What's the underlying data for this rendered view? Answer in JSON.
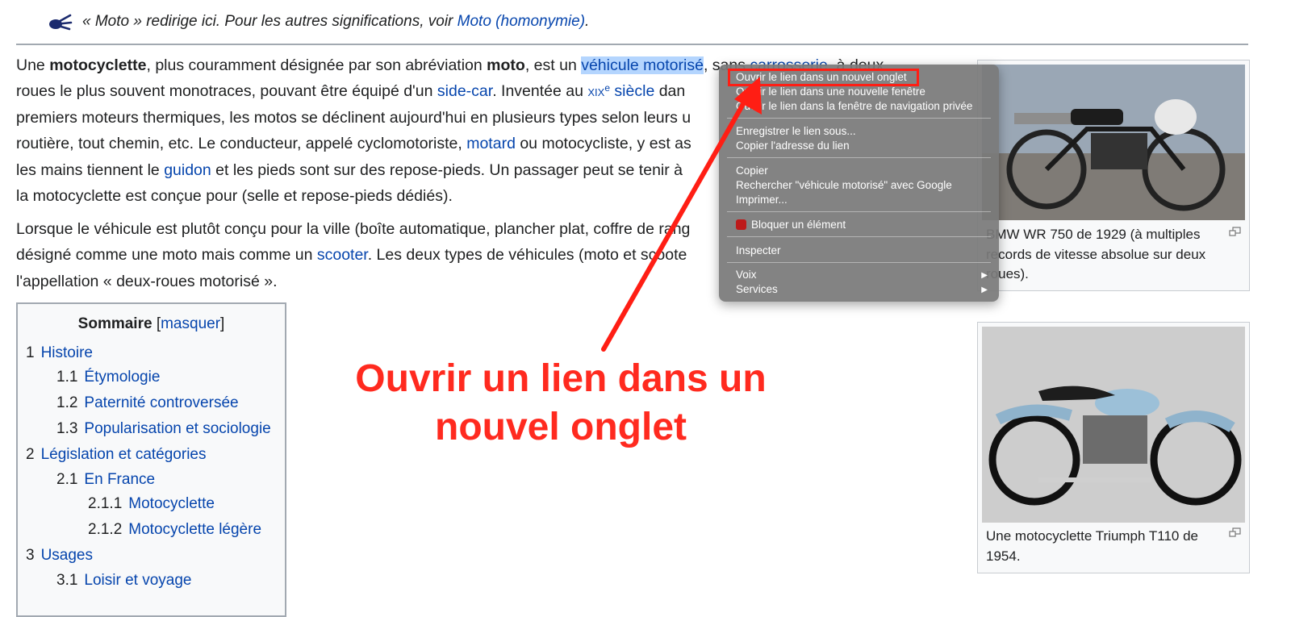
{
  "hatnote": {
    "icon": "disambiguation-icon",
    "prefix": "« Moto » redirige ici. Pour les autres significations, voir ",
    "link": "Moto (homonymie)",
    "suffix": "."
  },
  "intro": {
    "l1": [
      "Une ",
      "motocyclette",
      ", plus couramment désignée par son abréviation ",
      "moto",
      ", est un ",
      "véhicule motorisé",
      ", sans ",
      "carrosserie",
      ", à deux"
    ],
    "l2": [
      "roues le plus souvent monotraces, pouvant être équipé d'un ",
      "side-car",
      ". Inventée au ",
      "xix",
      "e",
      " siècle",
      " dan"
    ],
    "l3": "premiers moteurs thermiques, les motos se déclinent aujourd'hui en plusieurs types selon leurs u",
    "l4": [
      "routière, tout chemin, etc. Le conducteur, appelé cyclomotoriste, ",
      "motard",
      " ou motocycliste, y est as"
    ],
    "l5": [
      "les mains tiennent le ",
      "guidon",
      " et les pieds sont sur des repose-pieds. Un passager peut se tenir à"
    ],
    "l6": "la motocyclette est conçue pour (selle et repose-pieds dédiés)."
  },
  "para2": {
    "l1": "Lorsque le véhicule est plutôt conçu pour la ville (boîte automatique, plancher plat, coffre de rang",
    "l2": [
      "désigné comme une moto mais comme un ",
      "scooter",
      ". Les deux types de véhicules (moto et scoote"
    ],
    "l3": "l'appellation « deux-roues motorisé »."
  },
  "thumbs": [
    {
      "caption": "BMW WR 750 de 1929 (à multiples records de vitesse absolue sur deux roues)."
    },
    {
      "caption": "Une motocyclette Triumph T110 de 1954."
    }
  ],
  "toc": {
    "title": "Sommaire",
    "toggle_open": "[",
    "toggle": "masquer",
    "toggle_close": "]",
    "items": [
      {
        "num": "1",
        "label": "Histoire"
      },
      {
        "num": "1.1",
        "label": "Étymologie"
      },
      {
        "num": "1.2",
        "label": "Paternité controversée"
      },
      {
        "num": "1.3",
        "label": "Popularisation et sociologie"
      },
      {
        "num": "2",
        "label": "Législation et catégories"
      },
      {
        "num": "2.1",
        "label": "En France"
      },
      {
        "num": "2.1.1",
        "label": "Motocyclette"
      },
      {
        "num": "2.1.2",
        "label": "Motocyclette légère"
      },
      {
        "num": "3",
        "label": "Usages"
      },
      {
        "num": "3.1",
        "label": "Loisir et voyage"
      }
    ]
  },
  "context_menu": {
    "items": [
      "Ouvrir le lien dans un nouvel onglet",
      "Ouvrir le lien dans une nouvelle fenêtre",
      "Ouvrir le lien dans la fenêtre de navigation privée",
      "Enregistrer le lien sous...",
      "Copier l'adresse du lien",
      "Copier",
      "Rechercher \"véhicule motorisé\" avec Google",
      "Imprimer...",
      "Bloquer un élément",
      "Inspecter",
      "Voix",
      "Services"
    ],
    "submenu_arrow": "▶"
  },
  "annotation": {
    "line1": "Ouvrir un lien dans un",
    "line2": "nouvel onglet",
    "color": "#ff2a1f"
  }
}
